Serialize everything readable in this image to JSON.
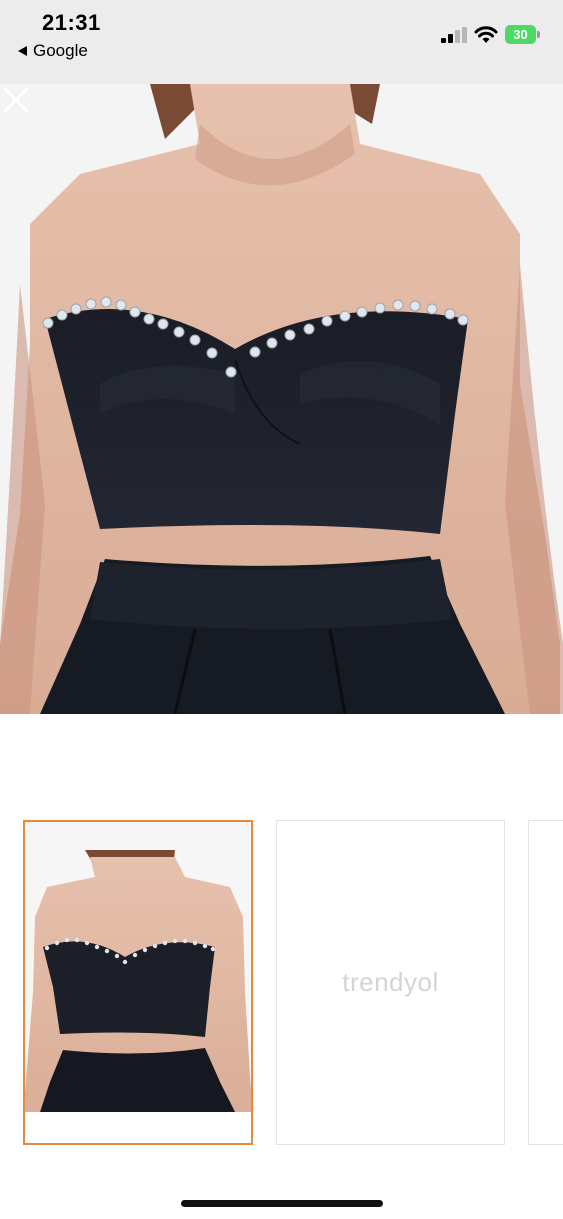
{
  "status_bar": {
    "time": "21:31",
    "back_app": "Google",
    "battery_level": "30",
    "icons": [
      "signal-icon",
      "wifi-icon",
      "battery-icon"
    ],
    "battery_color": "#4cd964"
  },
  "viewer": {
    "close_icon": "close-icon",
    "main_image": "black strapless bustier crop top with rhinestone trim, worn with black high-waist skirt"
  },
  "thumbnails": [
    {
      "state": "selected",
      "border_color": "#e48a3a"
    },
    {
      "state": "loading",
      "placeholder_text": "trendyol"
    },
    {
      "state": "partially-visible"
    }
  ]
}
